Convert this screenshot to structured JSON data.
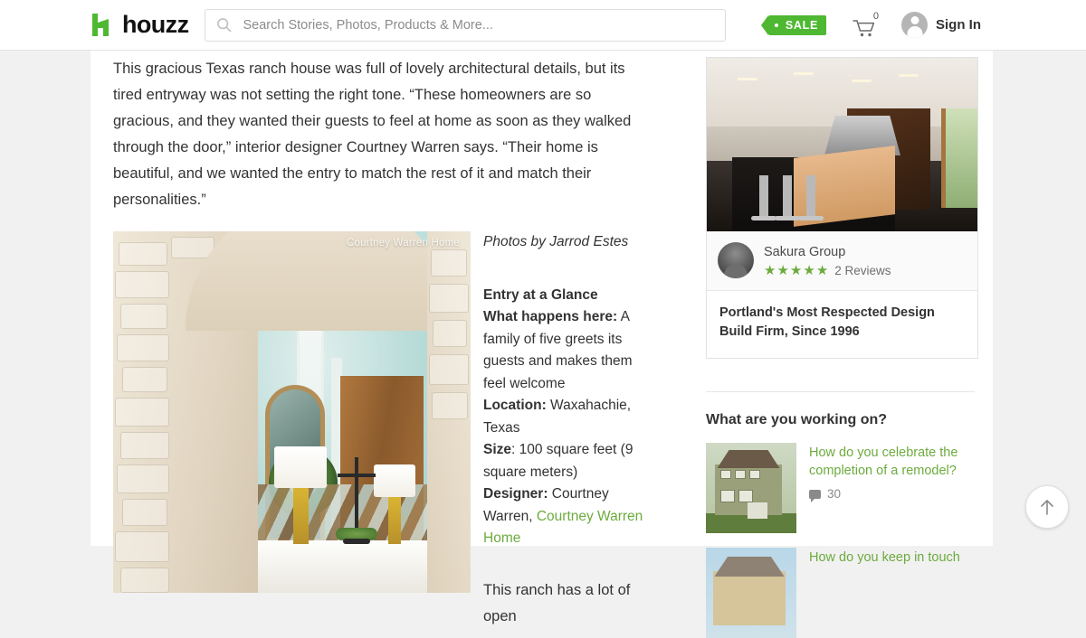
{
  "header": {
    "logo_text": "houzz",
    "search": {
      "placeholder": "Search Stories, Photos, Products & More...",
      "value": ""
    },
    "sale_label": "SALE",
    "cart_count": "0",
    "signin_label": "Sign In"
  },
  "article": {
    "intro": "This gracious Texas ranch house was full of lovely architectural details, but its tired entryway was not setting the right tone. “These homeowners are so gracious, and they wanted their guests to feel at home as soon as they walked through the door,” interior designer Courtney Warren says. “Their home is beautiful, and we wanted the entry to match the rest of it and match their personalities.”",
    "hero_watermark": "Courtney Warren Home",
    "photo_credit": "Photos by Jarrod Estes",
    "glance": {
      "title": "Entry at a Glance",
      "what_label": "What happens here:",
      "what_value": " A family of five greets its guests and makes them feel welcome",
      "location_label": "Location:",
      "location_value": " Waxahachie, Texas",
      "size_label": "Size",
      "size_value": ": 100 square feet (9 square meters)",
      "designer_label": "Designer:",
      "designer_value": " Courtney Warren, ",
      "designer_link": "Courtney Warren Home"
    },
    "body_after": "This ranch has a lot of open"
  },
  "sidebar": {
    "ad": {
      "name": "Sakura Group",
      "stars": [
        "★",
        "★",
        "★",
        "★",
        "★"
      ],
      "reviews": "2 Reviews",
      "tagline": "Portland's Most Respected Design Build Firm, Since 1996"
    },
    "working_title": "What are you working on?",
    "questions": [
      {
        "link": "How do you celebrate the completion of a remodel?",
        "comments": "30"
      },
      {
        "link": "How do you keep in touch",
        "comments": ""
      }
    ]
  },
  "colors": {
    "brand_green": "#4fb832",
    "link_green": "#6cab3d",
    "page_bg": "#f1f1f1"
  }
}
